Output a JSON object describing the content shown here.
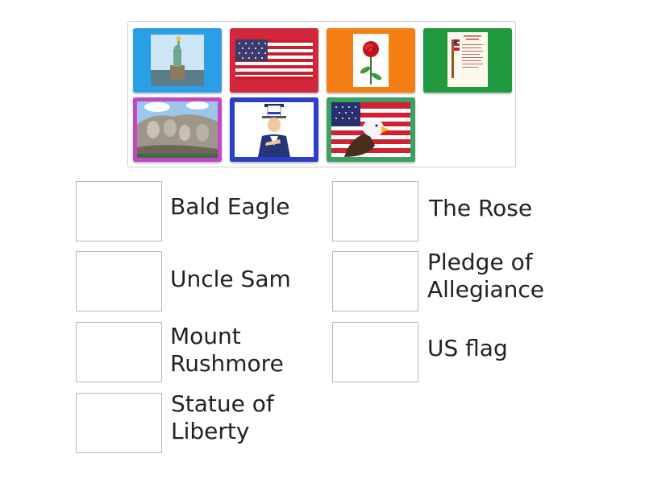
{
  "tray": {
    "tiles": [
      {
        "name": "statue-of-liberty-tile",
        "color": "#2b9fe6",
        "image": "statue-of-liberty-photo"
      },
      {
        "name": "us-flag-tile",
        "color": "#d3283b",
        "image": "american-flag-picture"
      },
      {
        "name": "rose-tile",
        "color": "#f47d14",
        "image": "red-rose-photo"
      },
      {
        "name": "pledge-of-allegiance-tile",
        "color": "#21993f",
        "image": "pledge-document-picture"
      },
      {
        "name": "mount-rushmore-tile",
        "color": "#c148c6",
        "image": "mount-rushmore-photo"
      },
      {
        "name": "uncle-sam-tile",
        "color": "#2b3fc9",
        "image": "uncle-sam-picture"
      },
      {
        "name": "bald-eagle-tile",
        "color": "#3ba163",
        "image": "eagle-and-flag-photo"
      }
    ]
  },
  "targets": [
    {
      "label": "Bald Eagle"
    },
    {
      "label": "Uncle Sam"
    },
    {
      "label": "Mount\nRushmore"
    },
    {
      "label": "Statue of\nLiberty"
    },
    {
      "label": "The Rose"
    },
    {
      "label": "Pledge of\nAllegiance"
    },
    {
      "label": "US flag"
    }
  ]
}
